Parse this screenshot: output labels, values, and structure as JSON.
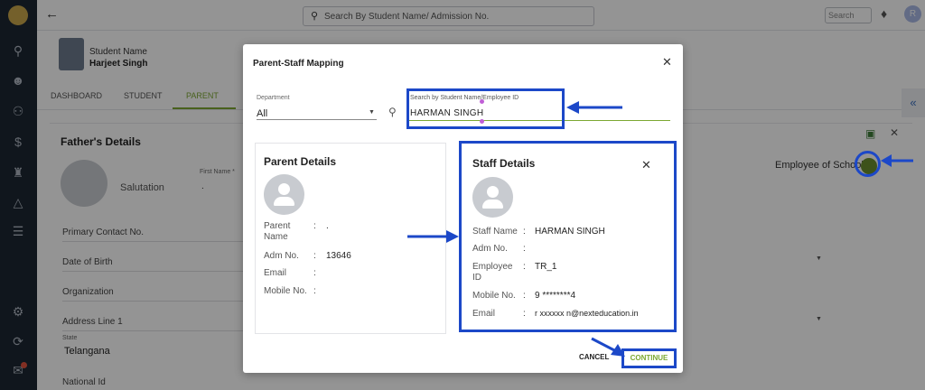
{
  "topbar": {
    "search_placeholder": "Search By Student Name/ Admission No.",
    "mini_search_placeholder": "Search",
    "avatar_initial": "R"
  },
  "student": {
    "label": "Student Name",
    "name": "Harjeet Singh"
  },
  "tabs": [
    "DASHBOARD",
    "STUDENT",
    "PARENT"
  ],
  "active_tab": "PARENT",
  "father": {
    "title": "Father's Details",
    "salutation_label": "Salutation",
    "first_name_label": "First Name *",
    "first_name_value": ".",
    "fields": [
      "Primary Contact No.",
      "Date of Birth",
      "Organization",
      "Address Line 1"
    ],
    "state_label": "State",
    "state_value": "Telangana",
    "national_id_label": "National Id",
    "employee_of_school_label": "Employee of School"
  },
  "modal": {
    "title": "Parent-Staff Mapping",
    "department_label": "Department",
    "department_value": "All",
    "search_label": "Search by Student Name/Employee ID",
    "search_value": "HARMAN  SINGH",
    "parent_card": {
      "title": "Parent Details",
      "rows": [
        {
          "label": "Parent Name",
          "value": "."
        },
        {
          "label": "Adm No.",
          "value": "13646"
        },
        {
          "label": "Email",
          "value": ""
        },
        {
          "label": "Mobile No.",
          "value": ""
        }
      ]
    },
    "staff_card": {
      "title": "Staff Details",
      "rows": [
        {
          "label": "Staff Name",
          "value": "HARMAN SINGH"
        },
        {
          "label": "Adm No.",
          "value": ""
        },
        {
          "label": "Employee ID",
          "value": "TR_1"
        },
        {
          "label": "Mobile No.",
          "value": "9 ********4"
        },
        {
          "label": "Email",
          "value": "r xxxxxx n@nexteducation.in"
        }
      ]
    },
    "cancel_label": "CANCEL",
    "continue_label": "CONTINUE"
  },
  "colors": {
    "sidebar_bg": "#1c2733",
    "accent_green": "#7ca832",
    "annotation_blue": "#1c48c8"
  }
}
